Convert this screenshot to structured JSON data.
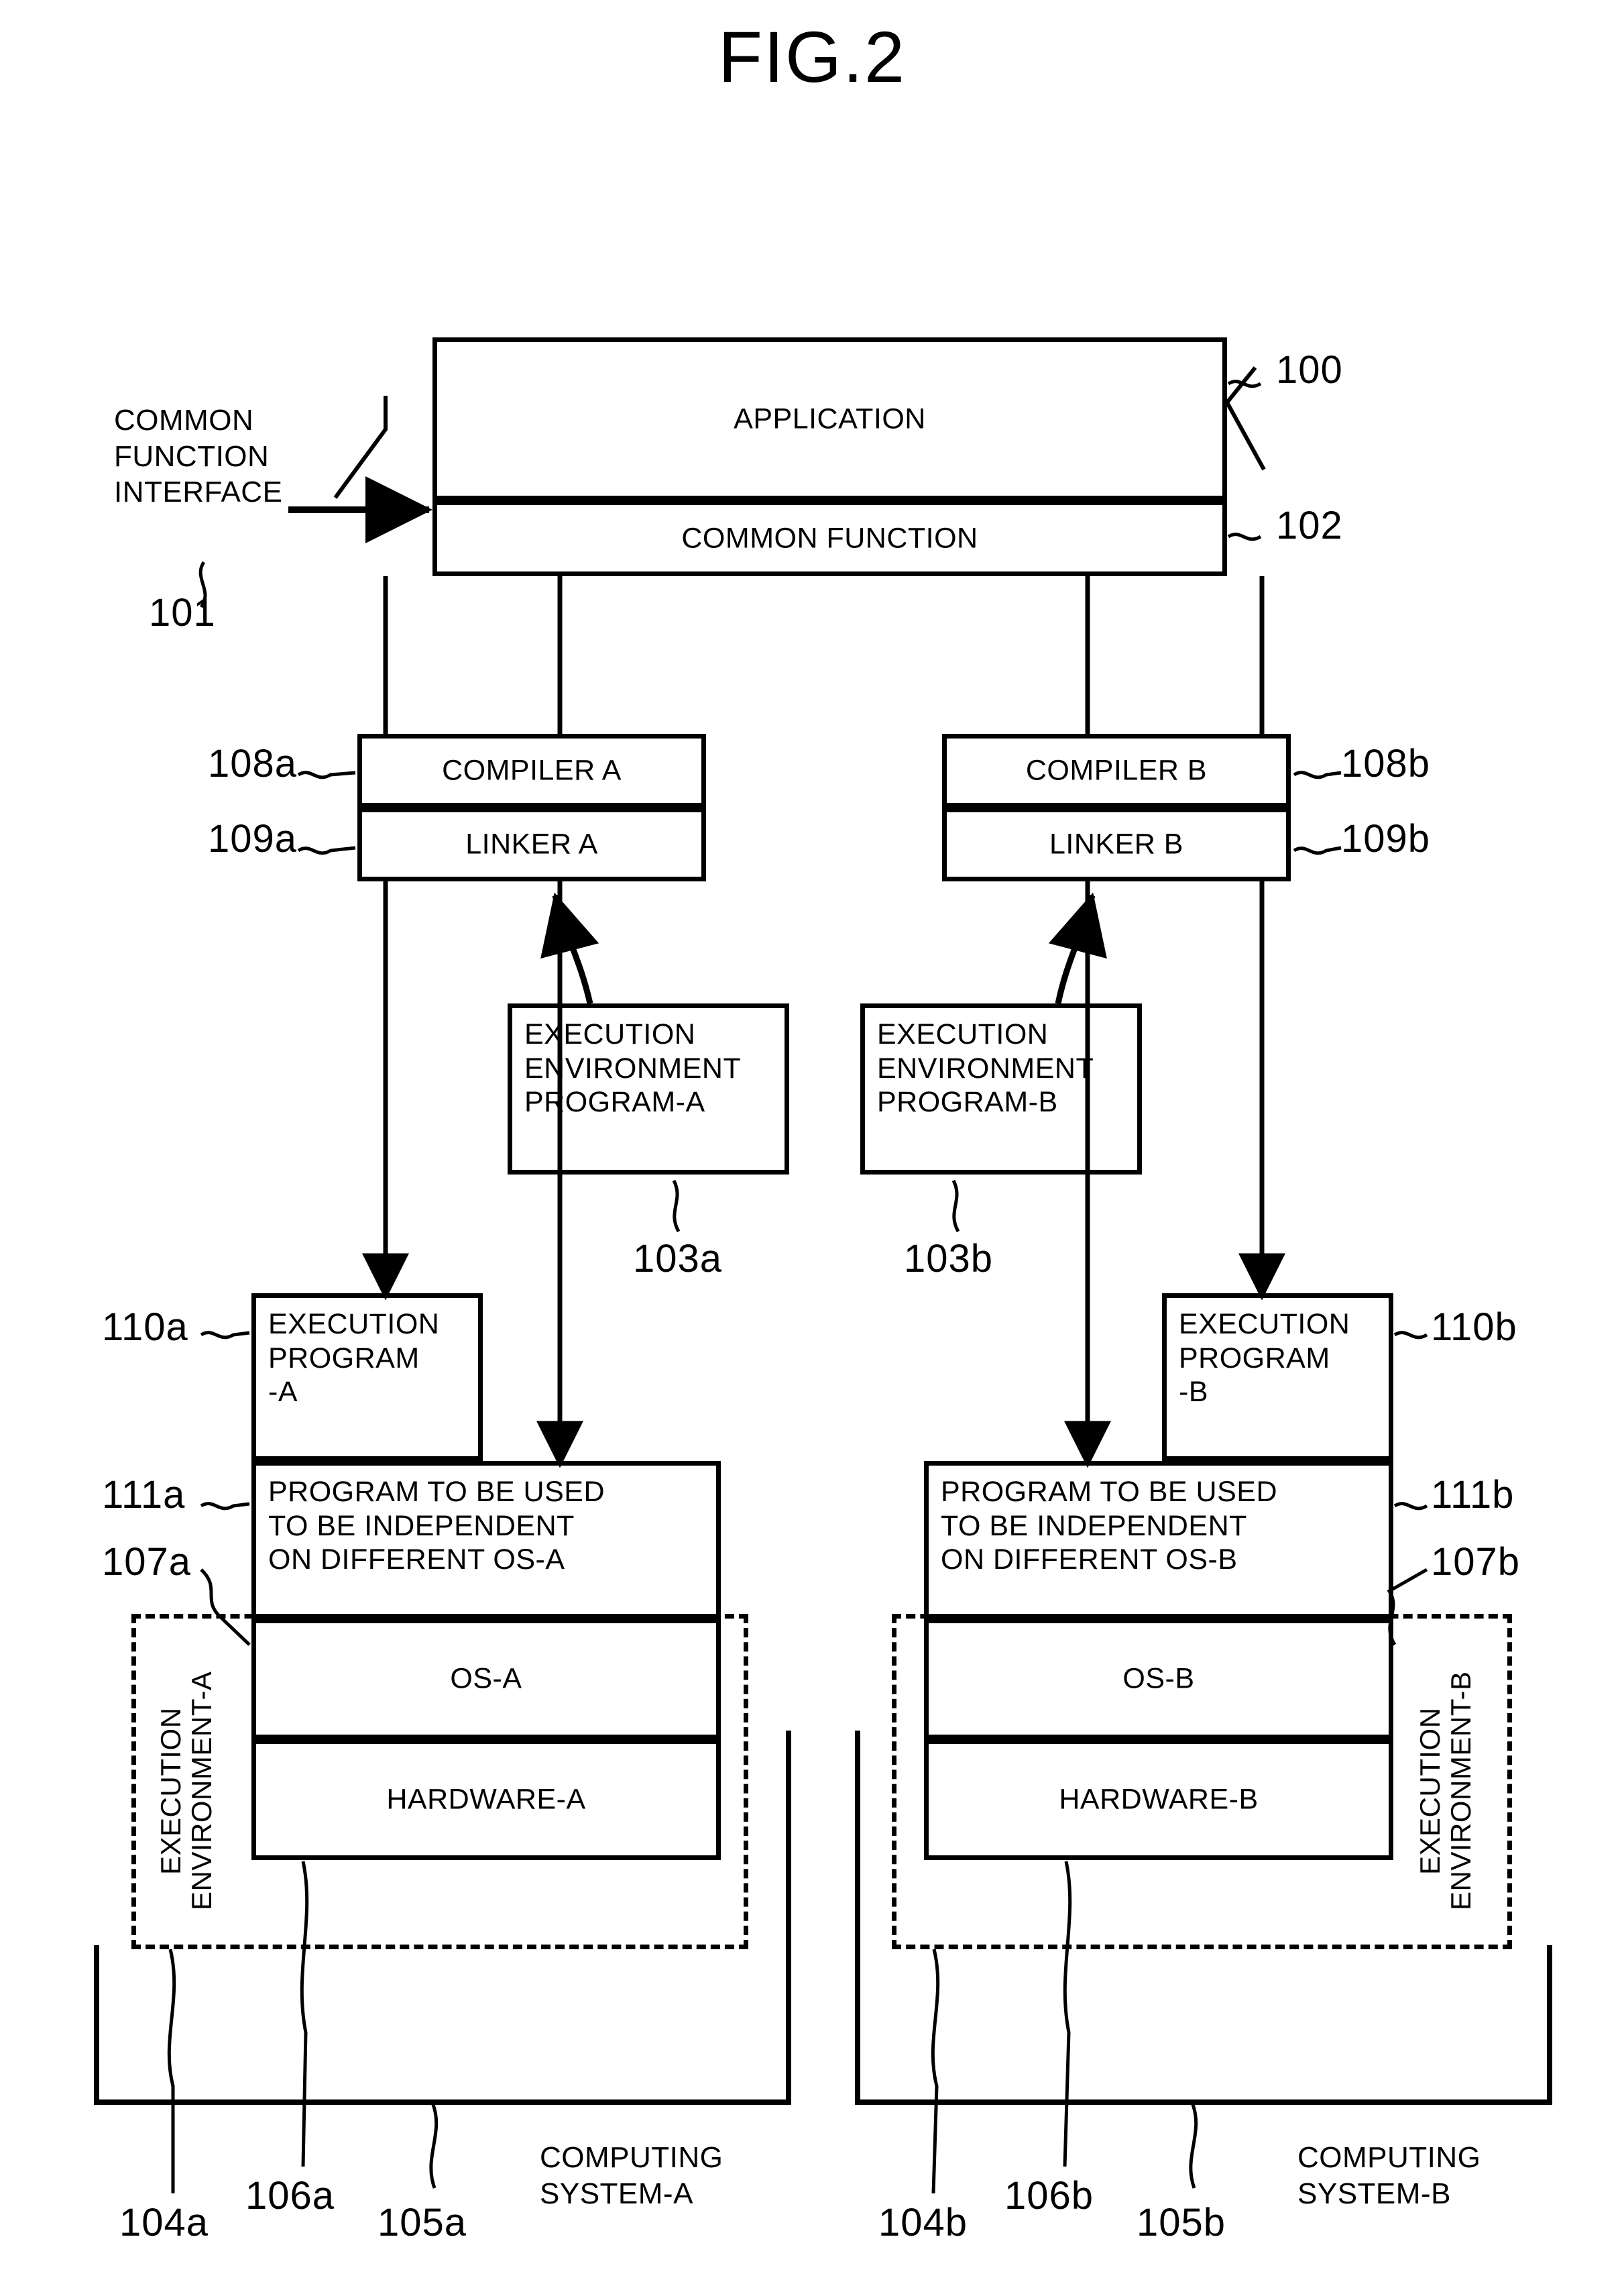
{
  "figure": {
    "title": "FIG.2"
  },
  "annotations": {
    "common_function_interface": "COMMON\nFUNCTION\nINTERFACE",
    "ref_101": "101",
    "ref_100": "100",
    "ref_102": "102",
    "ref_108a": "108a",
    "ref_109a": "109a",
    "ref_108b": "108b",
    "ref_109b": "109b",
    "ref_103a": "103a",
    "ref_103b": "103b",
    "ref_110a": "110a",
    "ref_110b": "110b",
    "ref_111a": "111a",
    "ref_111b": "111b",
    "ref_107a": "107a",
    "ref_107b": "107b",
    "ref_104a": "104a",
    "ref_105a": "105a",
    "ref_106a": "106a",
    "ref_104b": "104b",
    "ref_105b": "105b",
    "ref_106b": "106b"
  },
  "blocks": {
    "application": "APPLICATION",
    "common_function": "COMMON FUNCTION",
    "compiler_a": "COMPILER A",
    "linker_a": "LINKER A",
    "compiler_b": "COMPILER B",
    "linker_b": "LINKER B",
    "exec_env_program_a": "EXECUTION\nENVIRONMENT\nPROGRAM-A",
    "exec_env_program_b": "EXECUTION\nENVIRONMENT\nPROGRAM-B",
    "execution_program_a": "EXECUTION\nPROGRAM\n-A",
    "execution_program_b": "EXECUTION\nPROGRAM\n-B",
    "independent_program_a": "PROGRAM TO BE USED\nTO BE INDEPENDENT\nON DIFFERENT OS-A",
    "independent_program_b": "PROGRAM TO BE USED\nTO BE INDEPENDENT\nON DIFFERENT OS-B",
    "os_a": "OS-A",
    "os_b": "OS-B",
    "hardware_a": "HARDWARE-A",
    "hardware_b": "HARDWARE-B",
    "exec_env_a": "EXECUTION\nENVIRONMENT-A",
    "exec_env_b": "EXECUTION\nENVIRONMENT-B",
    "computing_system_a": "COMPUTING\nSYSTEM-A",
    "computing_system_b": "COMPUTING\nSYSTEM-B"
  }
}
